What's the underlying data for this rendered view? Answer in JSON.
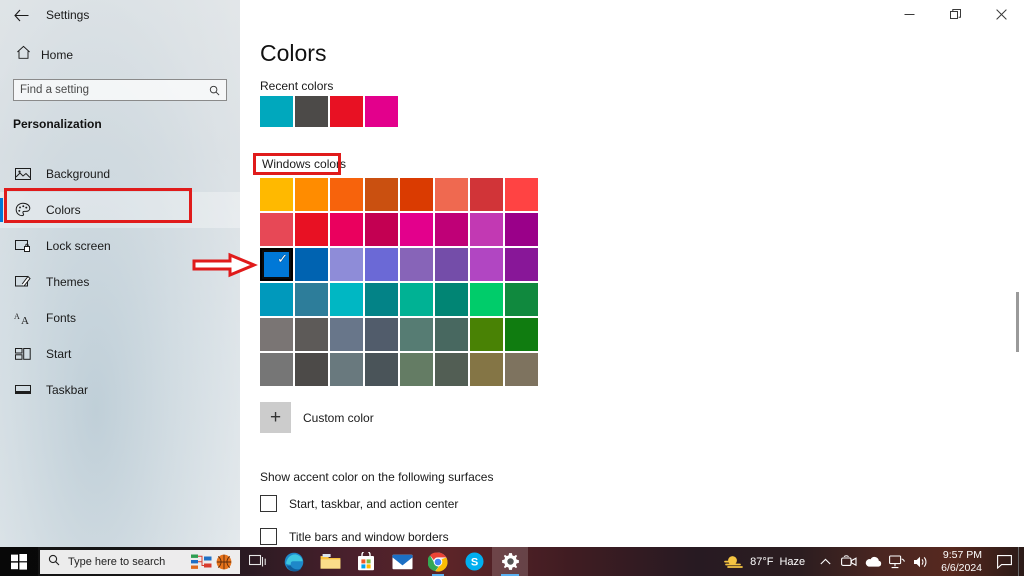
{
  "window": {
    "titlebar": {
      "back_icon": "back-arrow-icon",
      "title": "Settings"
    },
    "controls": {
      "minimize": "─",
      "maximize": "❐",
      "close": "✕"
    }
  },
  "sidebar": {
    "home": {
      "label": "Home",
      "icon": "home-icon"
    },
    "search": {
      "placeholder": "Find a setting",
      "icon": "search-icon"
    },
    "group_title": "Personalization",
    "items": [
      {
        "label": "Background",
        "icon": "picture-icon",
        "selected": false
      },
      {
        "label": "Colors",
        "icon": "palette-icon",
        "selected": true
      },
      {
        "label": "Lock screen",
        "icon": "lock-screen-icon",
        "selected": false
      },
      {
        "label": "Themes",
        "icon": "themes-icon",
        "selected": false
      },
      {
        "label": "Fonts",
        "icon": "fonts-icon",
        "selected": false
      },
      {
        "label": "Start",
        "icon": "start-icon",
        "selected": false
      },
      {
        "label": "Taskbar",
        "icon": "taskbar-icon",
        "selected": false
      }
    ]
  },
  "main": {
    "page_title": "Colors",
    "recent_colors_label": "Recent colors",
    "recent_colors": [
      "#00a8bd",
      "#4c4a48",
      "#e81123",
      "#e3008c"
    ],
    "windows_colors_label": "Windows colors",
    "windows_colors": [
      "#ffb900",
      "#ff8c00",
      "#f7630c",
      "#ca5010",
      "#da3b01",
      "#ef6950",
      "#d13438",
      "#ff4343",
      "#e74856",
      "#e81123",
      "#ea005e",
      "#c30052",
      "#e3008c",
      "#bf0077",
      "#c239b3",
      "#9a0089",
      "#0078d7",
      "#0063b1",
      "#8e8cd8",
      "#6b69d6",
      "#8764b8",
      "#744da9",
      "#b146c2",
      "#881798",
      "#0099bc",
      "#2d7d9a",
      "#00b7c3",
      "#038387",
      "#00b294",
      "#018574",
      "#00cc6a",
      "#10893e",
      "#7a7574",
      "#5d5a58",
      "#68768a",
      "#515c6b",
      "#567c73",
      "#486860",
      "#498205",
      "#107c10",
      "#767676",
      "#4c4a48",
      "#69797e",
      "#4a5459",
      "#647c64",
      "#525e54",
      "#847545",
      "#7e735f"
    ],
    "selected_color_index": 16,
    "selected_check_glyph": "✓",
    "custom_color": {
      "label": "Custom color",
      "plus_glyph": "+",
      "icon": "plus-icon"
    },
    "surfaces_label": "Show accent color on the following surfaces",
    "checkboxes": [
      {
        "label": "Start, taskbar, and action center",
        "checked": false
      },
      {
        "label": "Title bars and window borders",
        "checked": false
      }
    ]
  },
  "annotations": {
    "color": "#e01b1b",
    "rect_colors_nav": "highlight-colors-nav-item",
    "rect_windows_colors": "highlight-windows-colors-label",
    "arrow": "arrow-pointing-to-selected-swatch"
  },
  "taskbar": {
    "start_icon": "windows-start-icon",
    "search": {
      "placeholder": "Type here to search",
      "icon": "search-icon"
    },
    "cortana_icon": "task-view-icon",
    "news_icon": "basketball-icon",
    "apps": [
      {
        "name": "task-view-icon",
        "glyph": "☰"
      },
      {
        "name": "edge-icon",
        "glyph": "e"
      },
      {
        "name": "file-explorer-icon",
        "glyph": "📁"
      },
      {
        "name": "microsoft-store-icon",
        "glyph": "🛒"
      },
      {
        "name": "mail-icon",
        "glyph": "✉"
      },
      {
        "name": "chrome-icon",
        "glyph": "●"
      },
      {
        "name": "skype-icon",
        "glyph": "S"
      },
      {
        "name": "settings-icon",
        "glyph": "⚙"
      }
    ],
    "tray": {
      "weather_temp": "87°F",
      "weather_desc": "Haze",
      "weather_icon": "haze-sun-icon",
      "chevron": "∧",
      "icons": [
        "meet-now-icon",
        "onedrive-icon",
        "network-icon",
        "volume-icon"
      ],
      "time": "9:57 PM",
      "date": "6/6/2024",
      "action_center_icon": "action-center-icon"
    }
  }
}
